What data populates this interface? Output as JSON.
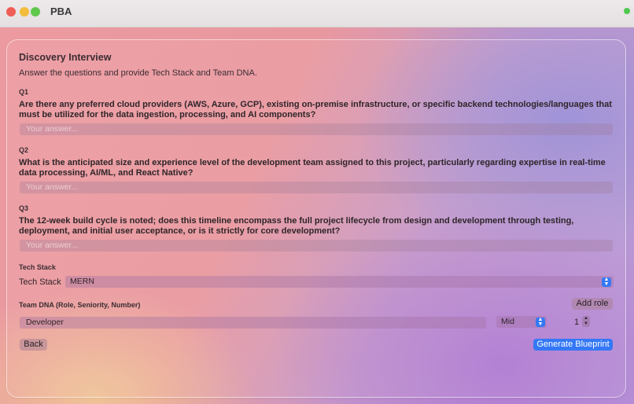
{
  "window": {
    "title": "PBA"
  },
  "header": {
    "title": "Discovery Interview",
    "subtitle": "Answer the questions and provide Tech Stack and Team DNA."
  },
  "questions": [
    {
      "label": "Q1",
      "text": "Are there any preferred cloud providers (AWS, Azure, GCP), existing on-premise infrastructure, or specific backend technologies/languages that must be utilized for the data ingestion, processing, and AI components?",
      "placeholder": "Your answer..."
    },
    {
      "label": "Q2",
      "text": "What is the anticipated size and experience level of the development team assigned to this project, particularly regarding expertise in real-time data processing, AI/ML, and React Native?",
      "placeholder": "Your answer..."
    },
    {
      "label": "Q3",
      "text": "The 12-week build cycle is noted; does this timeline encompass the full project lifecycle from design and development through testing, deployment, and initial user acceptance, or is it strictly for core development?",
      "placeholder": "Your answer..."
    }
  ],
  "tech_stack": {
    "section_title": "Tech Stack",
    "field_label": "Tech Stack",
    "selected": "MERN"
  },
  "team_dna": {
    "section_title": "Team DNA (Role, Seniority, Number)",
    "add_role_label": "Add role",
    "row": {
      "role": "Developer",
      "seniority": "Mid",
      "number": "1"
    }
  },
  "footer": {
    "back_label": "Back",
    "generate_label": "Generate Blueprint"
  },
  "colors": {
    "accent": "#3478f6"
  },
  "icons": {
    "select": "chevron-up-down-icon",
    "stepper": "stepper-icon"
  }
}
